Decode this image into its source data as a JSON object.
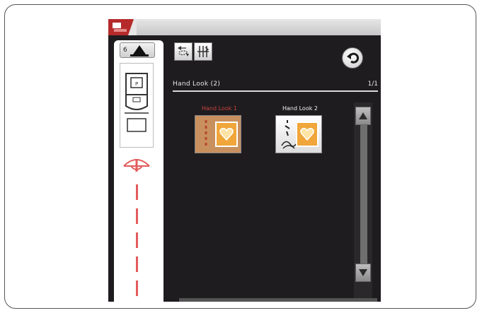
{
  "header": {
    "title": "Hand Look (2)",
    "page_indicator": "1/1"
  },
  "presser_foot": {
    "number": "6"
  },
  "stitches": [
    {
      "label": "Hand Look 1",
      "label_color": "#c9453e",
      "selected": false
    },
    {
      "label": "Hand Look 2",
      "label_color": "#f2f2f2",
      "selected": true
    }
  ],
  "icons": {
    "mode": "presser-foot-position-icon",
    "tool1": "mirror-image-icon",
    "tool2": "stitch-adjust-icon",
    "back": "back-arrow-icon",
    "scroll_up": "scroll-up-icon",
    "scroll_down": "scroll-down-icon"
  },
  "colors": {
    "screen_bg": "#1f1c1f",
    "accent_red": "#c9453e",
    "heart_orange": "#f0a63a"
  }
}
